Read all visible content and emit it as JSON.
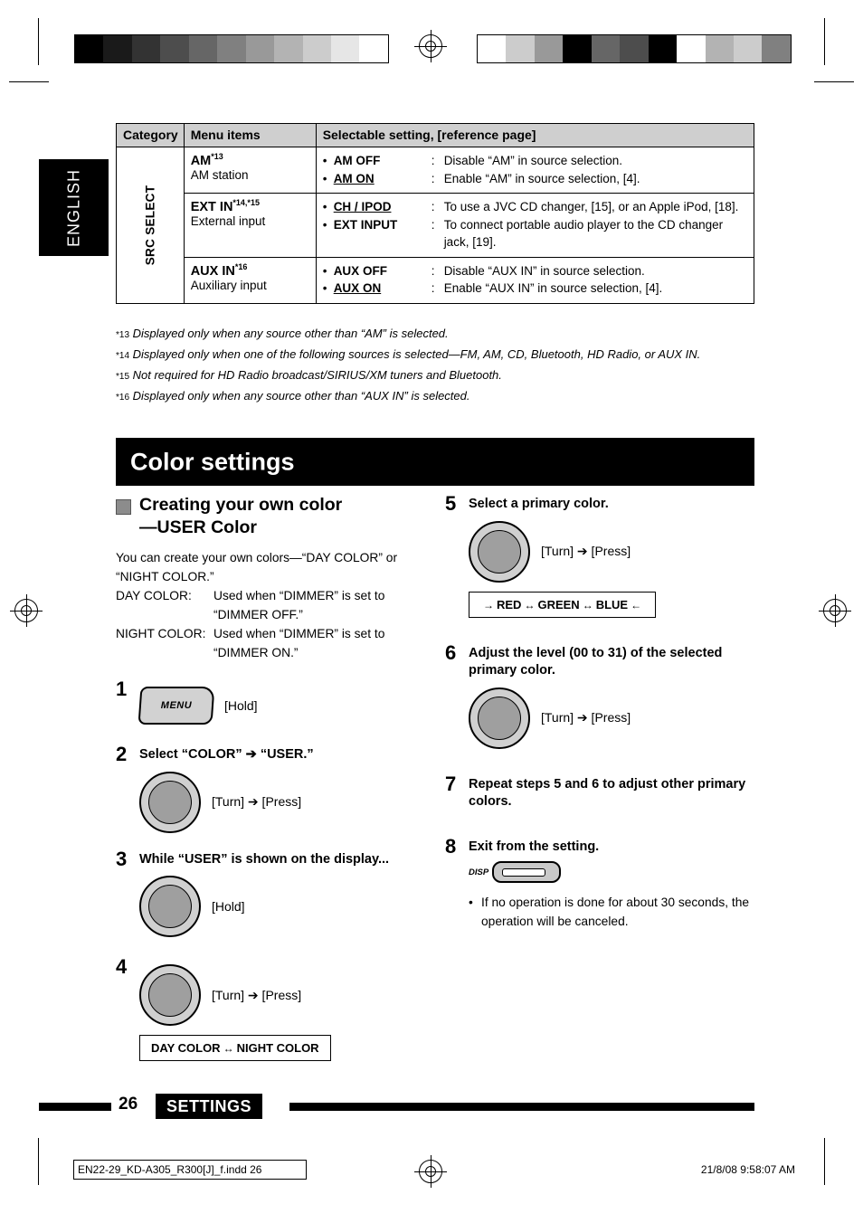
{
  "language_tab": "ENGLISH",
  "table": {
    "headers": [
      "Category",
      "Menu items",
      "Selectable setting, [reference page]"
    ],
    "category_label": "SRC SELECT",
    "rows": [
      {
        "item_title": "AM",
        "item_sup": "*13",
        "item_sub": "AM station",
        "options": [
          {
            "name": "AM OFF",
            "underline": false,
            "desc": "Disable “AM” in source selection."
          },
          {
            "name": "AM ON",
            "underline": true,
            "desc": "Enable “AM” in source selection, [4]."
          }
        ]
      },
      {
        "item_title": "EXT IN",
        "item_sup": "*14,*15",
        "item_sub": "External input",
        "options": [
          {
            "name": "CH / IPOD",
            "underline": true,
            "desc": "To use a JVC CD changer, [15], or an Apple iPod, [18]."
          },
          {
            "name": "EXT INPUT",
            "underline": false,
            "desc": "To connect portable audio player to the CD changer jack, [19]."
          }
        ]
      },
      {
        "item_title": "AUX IN",
        "item_sup": "*16",
        "item_sub": "Auxiliary input",
        "options": [
          {
            "name": "AUX OFF",
            "underline": false,
            "desc": "Disable “AUX IN” in source selection."
          },
          {
            "name": "AUX ON",
            "underline": true,
            "desc": "Enable “AUX IN” in source selection, [4]."
          }
        ]
      }
    ]
  },
  "footnotes": [
    {
      "marker": "*13",
      "text": "Displayed only when any source other than “AM” is selected."
    },
    {
      "marker": "*14",
      "text": "Displayed only when one of the following sources is selected—FM, AM, CD, Bluetooth, HD Radio, or AUX IN."
    },
    {
      "marker": "*15",
      "text": "Not required for HD Radio broadcast/SIRIUS/XM tuners and Bluetooth."
    },
    {
      "marker": "*16",
      "text": "Displayed only when any source other than “AUX IN” is selected."
    }
  ],
  "section_title": "Color settings",
  "left_column": {
    "heading_line1": "Creating your own color",
    "heading_line2": "—USER Color",
    "intro": "You can create your own colors—“DAY COLOR” or “NIGHT COLOR.”",
    "definitions": [
      {
        "key": "DAY COLOR:",
        "line1": "Used when “DIMMER” is set to",
        "line2": "“DIMMER OFF.”"
      },
      {
        "key": "NIGHT COLOR:",
        "line1": "Used when “DIMMER” is set to",
        "line2": "“DIMMER ON.”"
      }
    ],
    "steps": [
      {
        "num": "1",
        "text": "",
        "control": "menu-button",
        "control_label": "MENU",
        "action": "[Hold]"
      },
      {
        "num": "2",
        "text": "Select “COLOR” ➔ “USER.”",
        "control": "knob",
        "action": "[Turn] ➔ [Press]"
      },
      {
        "num": "3",
        "text": "While “USER” is shown on the display...",
        "control": "knob",
        "action": "[Hold]"
      },
      {
        "num": "4",
        "text": "",
        "control": "knob",
        "action": "[Turn] ➔ [Press]",
        "cycle": [
          "DAY COLOR",
          "NIGHT COLOR"
        ]
      }
    ]
  },
  "right_column": {
    "steps": [
      {
        "num": "5",
        "text": "Select a primary color.",
        "control": "knob",
        "action": "[Turn] ➔ [Press]",
        "cycle": [
          "RED",
          "GREEN",
          "BLUE"
        ]
      },
      {
        "num": "6",
        "text": "Adjust the level (00 to 31) of the selected primary color.",
        "control": "knob",
        "action": "[Turn] ➔ [Press]"
      },
      {
        "num": "7",
        "text": "Repeat steps 5 and 6 to adjust other primary colors.",
        "control": "none",
        "action": ""
      },
      {
        "num": "8",
        "text": "Exit from the setting.",
        "control": "disp-button",
        "control_label": "DISP",
        "action": ""
      }
    ],
    "note": "If no operation is done for about 30 seconds, the operation will be canceled."
  },
  "footer": {
    "page_number": "26",
    "section_tag": "SETTINGS",
    "imprint_left": "EN22-29_KD-A305_R300[J]_f.indd   26",
    "imprint_right": "21/8/08   9:58:07 AM"
  },
  "print_marks": {
    "swatch_left": [
      "#000000",
      "#1a1a1a",
      "#333333",
      "#4d4d4d",
      "#666666",
      "#808080",
      "#999999",
      "#b3b3b3",
      "#cccccc",
      "#e6e6e6",
      "#ffffff"
    ],
    "swatch_right": [
      "#ffffff",
      "#cccccc",
      "#999999",
      "#000000",
      "#666666",
      "#4d4d4d",
      "#000000",
      "#ffffff",
      "#b3b3b3",
      "#cccccc",
      "#808080"
    ]
  }
}
